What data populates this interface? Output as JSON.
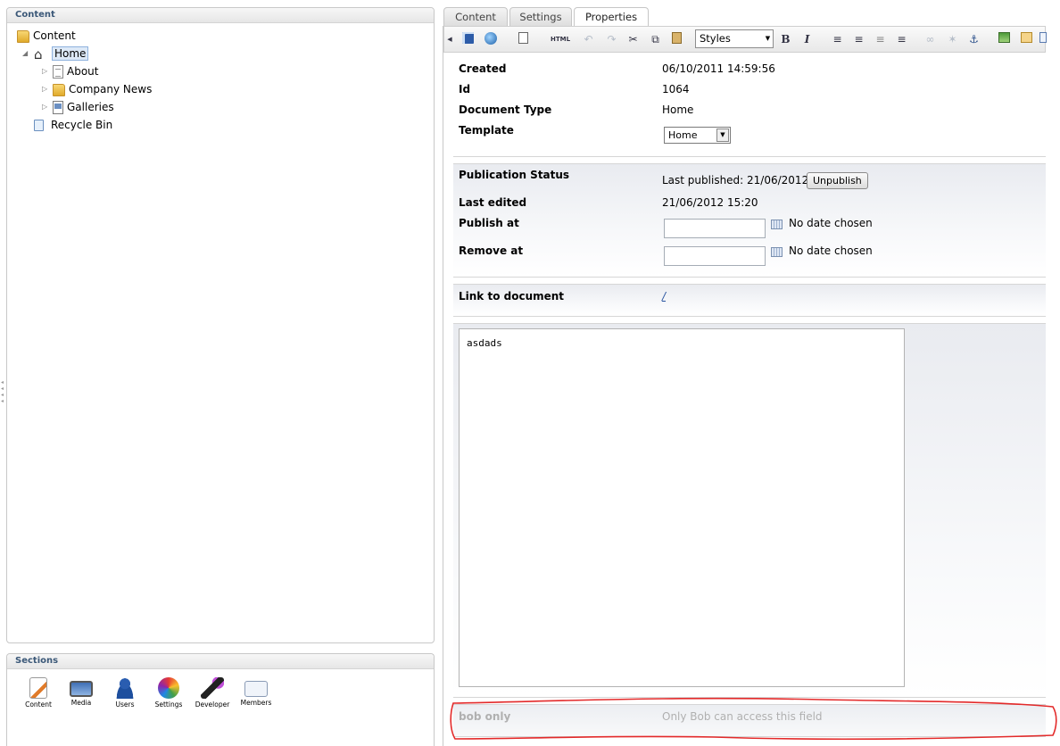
{
  "left_panel": {
    "header": "Content",
    "tree": {
      "root": "Content",
      "home": "Home",
      "children": [
        "About",
        "Company News",
        "Galleries"
      ],
      "recycle_bin": "Recycle Bin"
    }
  },
  "sections_panel": {
    "header": "Sections",
    "items": [
      "Content",
      "Media",
      "Users",
      "Settings",
      "Developer",
      "Members"
    ]
  },
  "tabs": [
    "Content",
    "Settings",
    "Properties"
  ],
  "active_tab": "Properties",
  "toolbar": {
    "styles_label": "Styles",
    "html_label": "HTML",
    "bold_label": "B",
    "italic_label": "I"
  },
  "properties": {
    "created_label": "Created",
    "created_value": "06/10/2011 14:59:56",
    "id_label": "Id",
    "id_value": "1064",
    "doctype_label": "Document Type",
    "doctype_value": "Home",
    "template_label": "Template",
    "template_value": "Home"
  },
  "publication": {
    "status_label": "Publication Status",
    "last_published": "Last published: 21/06/2012",
    "unpublish_label": "Unpublish",
    "last_edited_label": "Last edited",
    "last_edited_value": "21/06/2012 15:20",
    "publish_at_label": "Publish at",
    "publish_at_note": "No date chosen",
    "remove_at_label": "Remove at",
    "remove_at_note": "No date chosen"
  },
  "link": {
    "label": "Link to document",
    "value": "/"
  },
  "editor": {
    "text": "asdads"
  },
  "restricted": {
    "label": "bob only",
    "note": "Only Bob can access this field",
    "annotation_color": "#e32a2a"
  }
}
